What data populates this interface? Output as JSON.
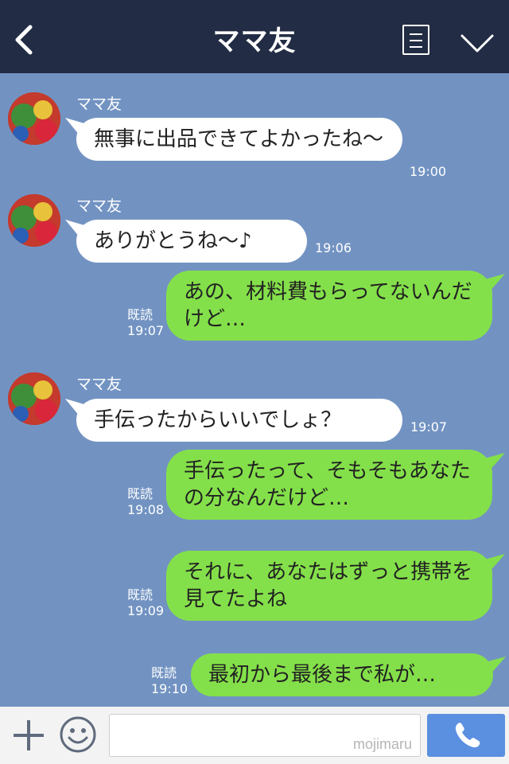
{
  "header": {
    "title": "ママ友"
  },
  "messages": [
    {
      "type": "incoming",
      "sender": "ママ友",
      "text": "無事に出品できてよかったね〜",
      "time": "19:00"
    },
    {
      "type": "incoming",
      "sender": "ママ友",
      "text": "ありがとうね〜♪",
      "time": "19:06"
    },
    {
      "type": "outgoing",
      "read": "既読",
      "text": "あの、材料費もらってないんだけど…",
      "time": "19:07"
    },
    {
      "type": "incoming",
      "sender": "ママ友",
      "text": "手伝ったからいいでしょ？",
      "time": "19:07"
    },
    {
      "type": "outgoing",
      "read": "既読",
      "text": "手伝ったって、そもそもあなたの分なんだけど…",
      "time": "19:08"
    },
    {
      "type": "outgoing",
      "read": "既読",
      "text": "それに、あなたはずっと携帯を見てたよね",
      "time": "19:09"
    },
    {
      "type": "outgoing",
      "read": "既読",
      "text": "最初から最後まで私が…",
      "time": "19:10"
    }
  ],
  "footer": {
    "input_value": "",
    "watermark": "mojimaru"
  },
  "icons": [
    "back-icon",
    "menu-icon",
    "chevron-down-icon",
    "plus-icon",
    "emoji-icon",
    "phone-icon"
  ],
  "colors": {
    "header_bg": "#222c44",
    "chat_bg": "#7293c2",
    "outgoing_bubble": "#84e04a",
    "incoming_bubble": "#ffffff",
    "call_button": "#5b8fe0"
  }
}
